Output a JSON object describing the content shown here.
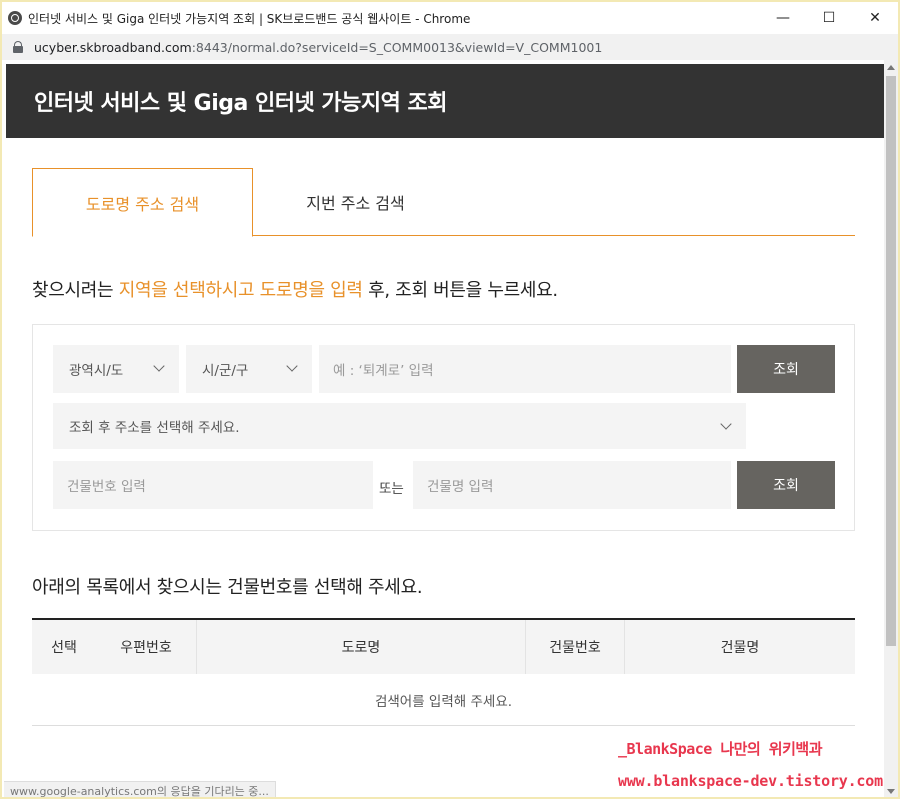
{
  "window": {
    "title": "인터넷 서비스 및 Giga 인터넷 가능지역 조회 | SK브로드밴드 공식 웹사이트 - Chrome",
    "minimize": "—",
    "maximize": "☐",
    "close": "✕"
  },
  "address": {
    "host": "ucyber.skbroadband.com",
    "path": ":8443/normal.do?serviceId=S_COMM0013&viewId=V_COMM1001"
  },
  "page": {
    "heading": "인터넷 서비스 및 Giga 인터넷 가능지역 조회",
    "tabs": [
      {
        "label": "도로명 주소 검색",
        "active": true
      },
      {
        "label": "지번 주소 검색",
        "active": false
      }
    ],
    "instruction": {
      "part1": "찾으시려는 ",
      "highlight1": "지역을 선택하시고",
      "part2": " ",
      "highlight2": "도로명을 입력",
      "part3": " 후, 조회 버튼을 누르세요."
    },
    "search": {
      "region_select": "광역시/도",
      "city_select": "시/군/구",
      "road_placeholder": "예 : ‘퇴계로’ 입력",
      "search_button": "조회",
      "address_select": "조회 후 주소를 선택해 주세요.",
      "building_no_placeholder": "건물번호 입력",
      "or_text": "또는",
      "building_name_placeholder": "건물명 입력",
      "search_button2": "조회"
    },
    "list_title": "아래의 목록에서 찾으시는 건물번호를 선택해 주세요.",
    "table": {
      "headers": [
        "선택",
        "우편번호",
        "도로명",
        "건물번호",
        "건물명"
      ],
      "empty_message": "검색어를 입력해 주세요."
    }
  },
  "watermark": {
    "line1": "_BlankSpace 나만의 위키백과",
    "line2": "www.blankspace-dev.tistory.com"
  },
  "status_text": "www.google-analytics.com의 응답을 기다리는 중..."
}
